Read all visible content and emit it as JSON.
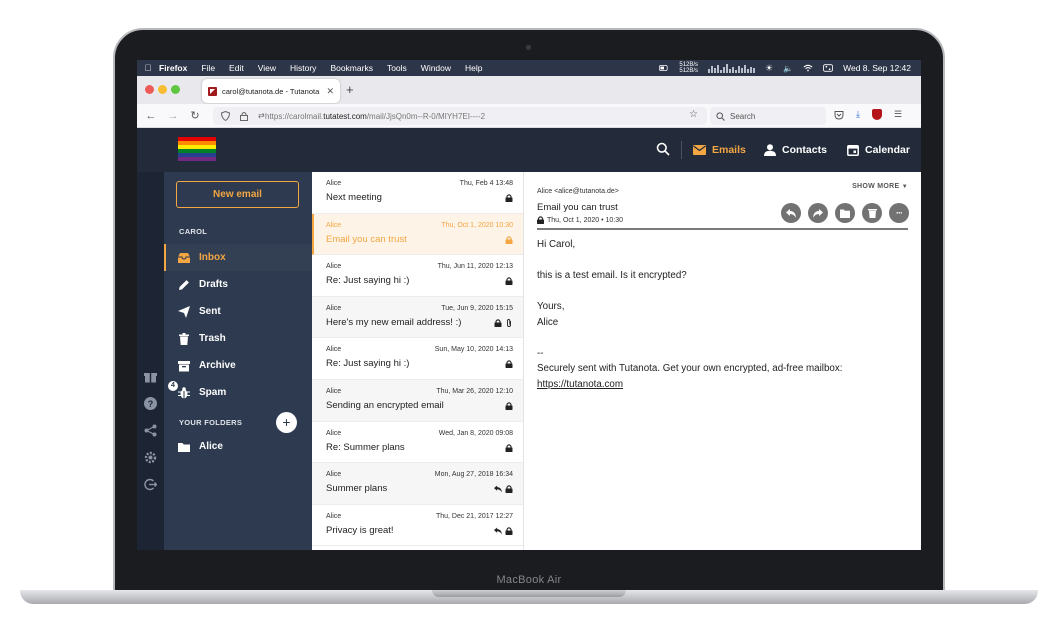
{
  "device": {
    "brand_label": "MacBook Air"
  },
  "menubar": {
    "app": "Firefox",
    "items": [
      "File",
      "Edit",
      "View",
      "History",
      "Bookmarks",
      "Tools",
      "Window",
      "Help"
    ],
    "net_up": "512B/s",
    "net_down": "512B/s",
    "clock": "Wed 8. Sep  12:42"
  },
  "browser": {
    "tab_title": "carol@tutanota.de - Tutanota",
    "url_prefix": "https://carolmail.",
    "url_domain": "tutatest.com",
    "url_path": "/mail/JjsQn0m--R-0/MIYH7EI----2",
    "search_placeholder": "Search"
  },
  "header": {
    "logo_colors": [
      "#e40303",
      "#ff8c00",
      "#ffed00",
      "#008026",
      "#24408e",
      "#732982"
    ],
    "nav": [
      {
        "label": "Emails",
        "icon": "envelope-icon",
        "active": true
      },
      {
        "label": "Contacts",
        "icon": "person-icon",
        "active": false
      },
      {
        "label": "Calendar",
        "icon": "calendar-icon",
        "active": false
      }
    ]
  },
  "sidebar": {
    "new_email_label": "New email",
    "account_label": "CAROL",
    "folders": [
      {
        "label": "Inbox",
        "icon": "inbox-icon",
        "active": true
      },
      {
        "label": "Drafts",
        "icon": "pencil-icon"
      },
      {
        "label": "Sent",
        "icon": "paper-plane-icon"
      },
      {
        "label": "Trash",
        "icon": "trash-icon"
      },
      {
        "label": "Archive",
        "icon": "archive-icon"
      },
      {
        "label": "Spam",
        "icon": "bug-icon",
        "badge": "4"
      }
    ],
    "your_folders_label": "YOUR FOLDERS",
    "custom_folders": [
      {
        "label": "Alice",
        "icon": "folder-icon"
      }
    ]
  },
  "mail_list": [
    {
      "from": "Alice",
      "date": "Thu, Feb 4 13:48",
      "subject": "Next meeting",
      "icons": [
        "lock"
      ]
    },
    {
      "from": "Alice",
      "date": "Thu, Oct 1, 2020 10:30",
      "subject": "Email you can trust",
      "icons": [
        "lock"
      ],
      "selected": true
    },
    {
      "from": "Alice",
      "date": "Thu, Jun 11, 2020 12:13",
      "subject": "Re: Just saying hi :)",
      "icons": [
        "lock"
      ]
    },
    {
      "from": "Alice",
      "date": "Tue, Jun 9, 2020 15:15",
      "subject": "Here's my new email address! :)",
      "icons": [
        "lock",
        "paperclip"
      ]
    },
    {
      "from": "Alice",
      "date": "Sun, May 10, 2020 14:13",
      "subject": "Re: Just saying hi :)",
      "icons": [
        "lock"
      ]
    },
    {
      "from": "Alice",
      "date": "Thu, Mar 26, 2020 12:10",
      "subject": "Sending an encrypted email",
      "icons": [
        "lock"
      ]
    },
    {
      "from": "Alice",
      "date": "Wed, Jan 8, 2020 09:08",
      "subject": "Re: Summer plans",
      "icons": [
        "lock"
      ]
    },
    {
      "from": "Alice",
      "date": "Mon, Aug 27, 2018 16:34",
      "subject": "Summer plans",
      "icons": [
        "reply",
        "lock"
      ]
    },
    {
      "from": "Alice",
      "date": "Thu, Dec 21, 2017 12:27",
      "subject": "Privacy is great!",
      "icons": [
        "reply",
        "lock"
      ]
    }
  ],
  "reader": {
    "from": "Alice <alice@tutanota.de>",
    "show_more": "SHOW MORE",
    "subject": "Email you can trust",
    "date": "Thu, Oct 1, 2020 • 10:30",
    "body": {
      "greeting": "Hi Carol,",
      "line1": "this is a test email. Is it encrypted?",
      "closing": "Yours,",
      "name": "Alice",
      "sig_sep": "--",
      "sig_text": "Securely sent with Tutanota. Get your own encrypted, ad-free mailbox:",
      "sig_link": "https://tutanota.com"
    }
  },
  "colors": {
    "accent": "#f3a642",
    "header_bg": "#232b3b",
    "sidebar_bg": "#2d3a4f"
  }
}
